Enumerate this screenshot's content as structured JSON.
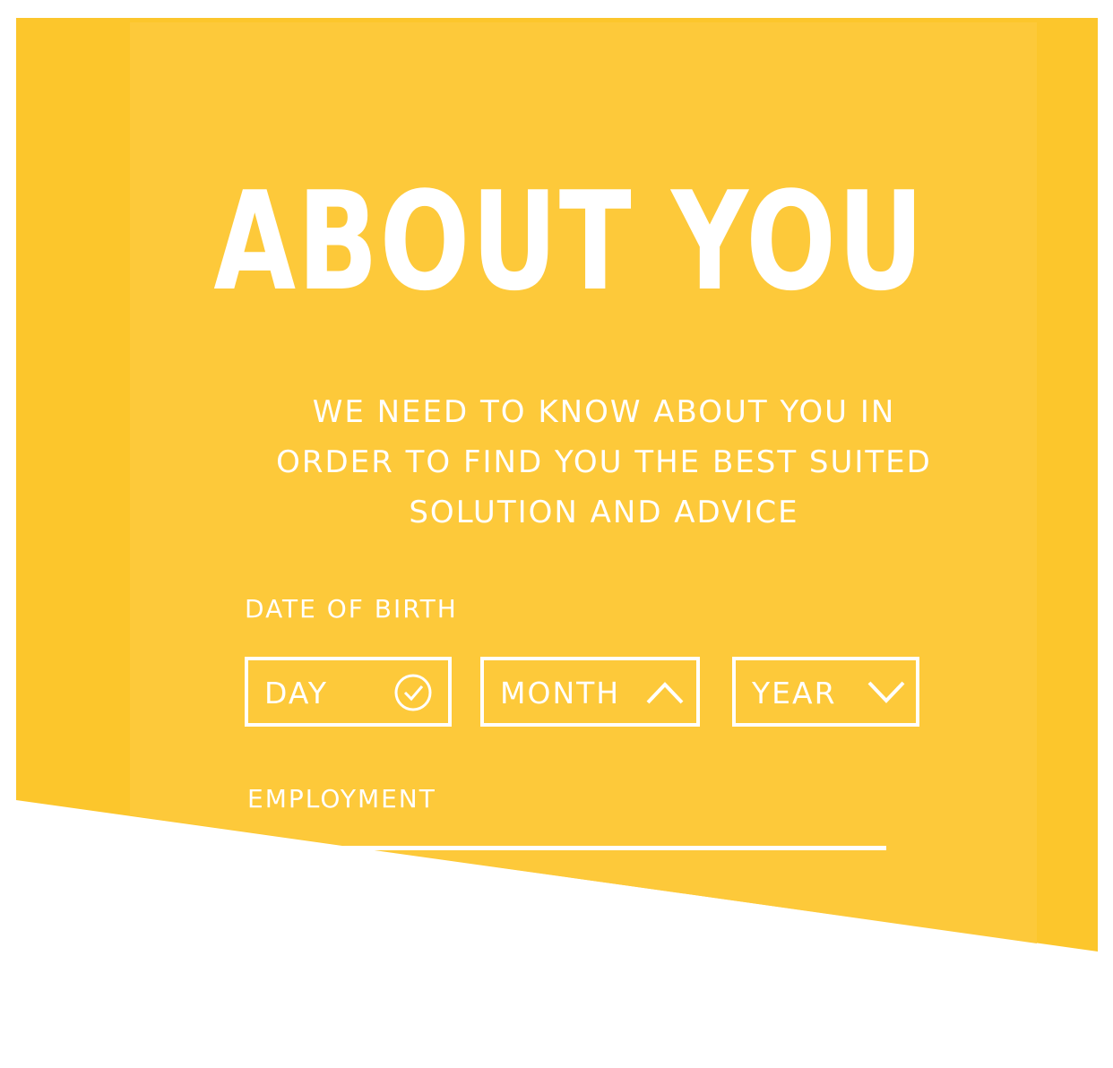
{
  "colors": {
    "panel": "#FDC93A",
    "panel_edge": "#FCC62C",
    "text": "#FFFFFF",
    "background": "#FFFFFF"
  },
  "page": {
    "title": "ABOUT YOU",
    "subtitle": "WE NEED TO KNOW ABOUT YOU IN ORDER TO FIND YOU THE BEST SUITED SOLUTION AND ADVICE"
  },
  "form": {
    "date_of_birth": {
      "label": "DATE OF BIRTH",
      "day": {
        "value": "DAY",
        "icon": "check-circle-icon"
      },
      "month": {
        "value": "MONTH",
        "icon": "chevron-up-icon"
      },
      "year": {
        "value": "YEAR",
        "icon": "chevron-down-icon"
      }
    },
    "employment": {
      "label": "EMPLOYMENT",
      "value": ""
    }
  }
}
